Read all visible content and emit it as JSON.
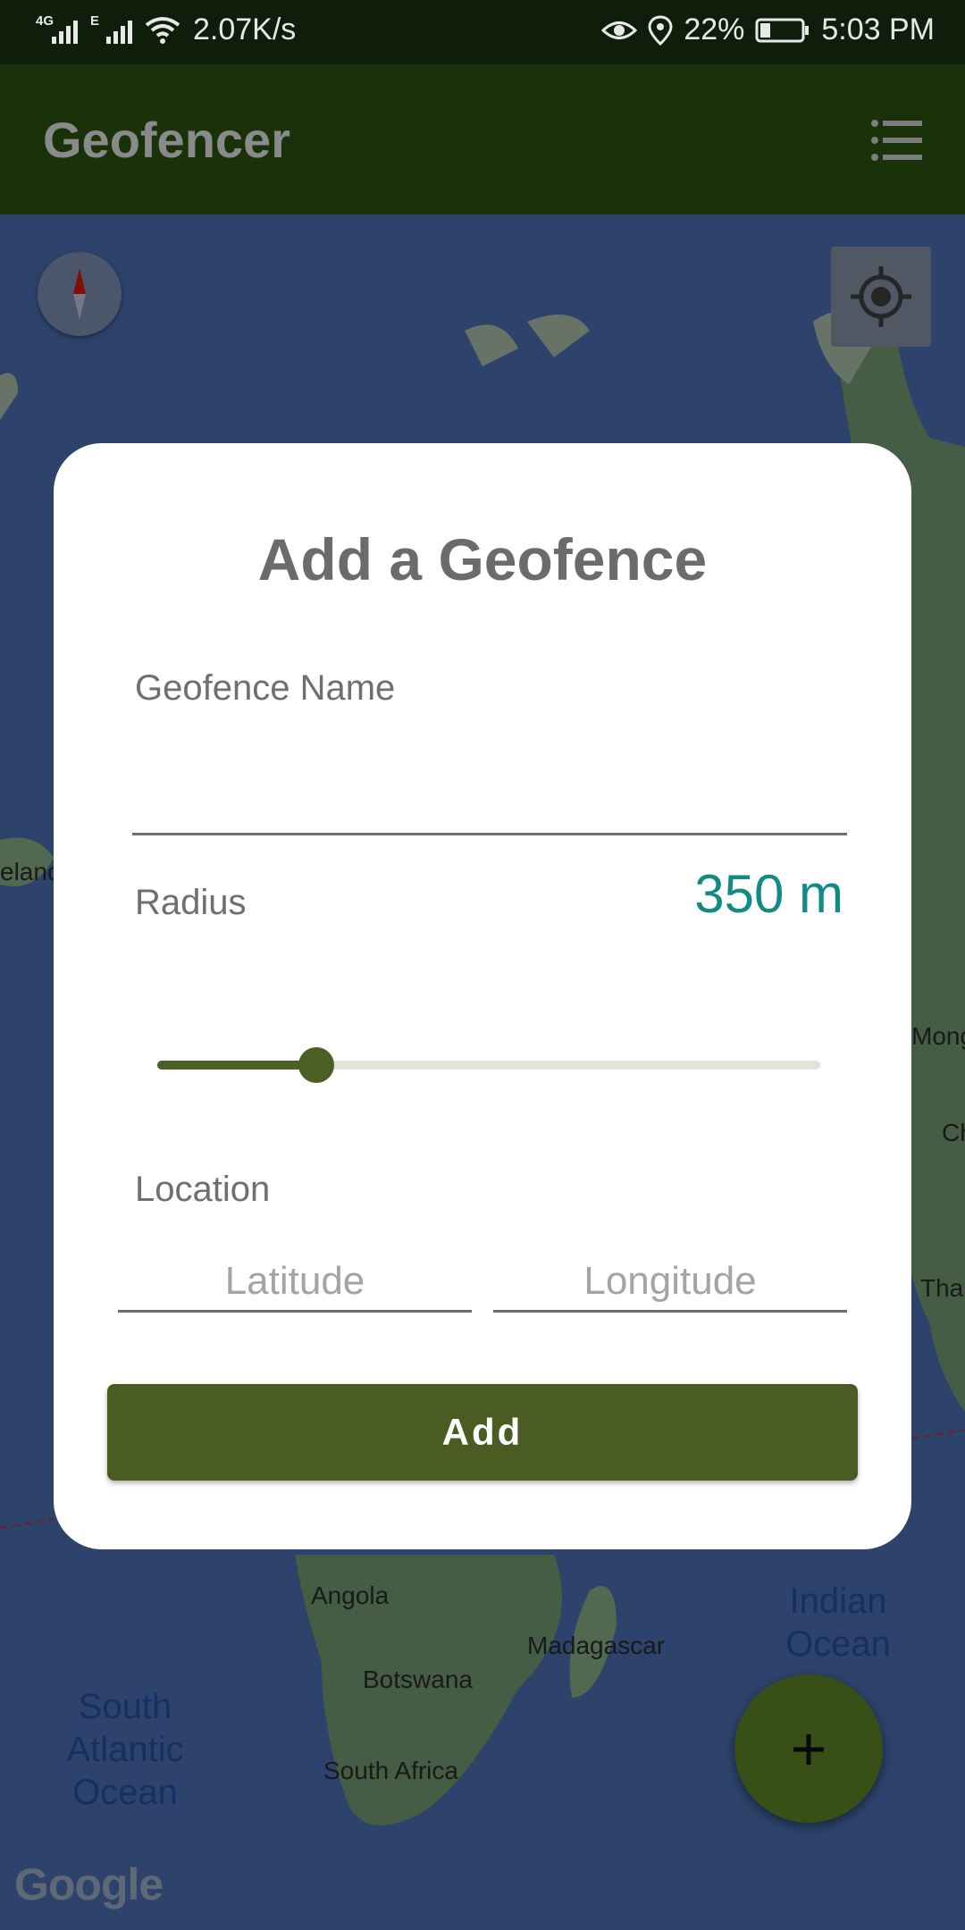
{
  "status_bar": {
    "network_speed": "2.07K/s",
    "signal1_type": "4G",
    "signal2_type": "E",
    "battery_percent": "22%",
    "time": "5:03 PM"
  },
  "app_bar": {
    "title": "Geofencer",
    "menu_icon": "list-menu-icon"
  },
  "map": {
    "labels": {
      "ireland": "eland",
      "mongolia": "Mong",
      "china": "Ch",
      "thailand": "Tha",
      "angola": "Angola",
      "botswana": "Botswana",
      "madagascar": "Madagascar",
      "south_africa": "South Africa",
      "indian_ocean_1": "Indian",
      "indian_ocean_2": "Ocean",
      "south_atlantic_1": "South",
      "south_atlantic_2": "Atlantic",
      "south_atlantic_3": "Ocean"
    },
    "attribution": "Google",
    "compass_icon": "compass-icon",
    "locate_icon": "my-location-icon"
  },
  "dialog": {
    "title": "Add a Geofence",
    "name_label": "Geofence Name",
    "name_value": "",
    "radius_label": "Radius",
    "radius_value": "350 m",
    "radius_fraction": 0.24,
    "location_label": "Location",
    "latitude_placeholder": "Latitude",
    "longitude_placeholder": "Longitude",
    "add_label": "Add"
  },
  "fab": {
    "label": "+"
  },
  "colors": {
    "app_bar": "#1a3209",
    "accent": "#4b5c22",
    "radius_value": "#138a84",
    "ocean": "#3c5a8f"
  }
}
